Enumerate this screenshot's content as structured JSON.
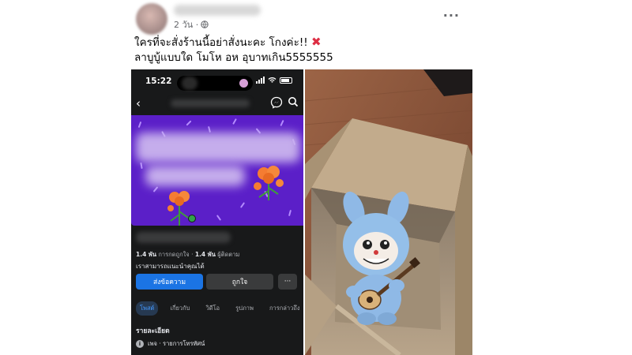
{
  "post": {
    "timestamp": "2 วัน ·",
    "caption_line1": "ใครที่จะสั่งร้านนี้อย่าสั่งนะคะ โกงค่ะ!!",
    "caption_line2": "ลาบูบู้แบบใด โมโห อห อุบาทเกิน5555555",
    "more_label": "···",
    "icons": [
      "globe-icon",
      "cross-mark-icon",
      "more-options-icon"
    ]
  },
  "screenshot": {
    "status_time": "15:22",
    "stats_likes_value": "1.4 พัน",
    "stats_likes_label": "การกดถูกใจ",
    "stats_followers_value": "1.4 พัน",
    "stats_followers_label": "ผู้ติดตาม",
    "suggest_text": "เราสามารถแนะนำคุณได้",
    "message_button": "ส่งข้อความ",
    "like_button": "ถูกใจ",
    "more_button": "···",
    "tabs": [
      "โพสต์",
      "เกี่ยวกับ",
      "วิดีโอ",
      "รูปภาพ",
      "การกล่าวถึง"
    ],
    "details_heading": "รายละเอียด",
    "details_row": "เพจ · รายการโทรทัศน์",
    "colors": {
      "cover": "#5b1fc8",
      "primary_button": "#1b74e4",
      "online": "#31a24c"
    }
  }
}
